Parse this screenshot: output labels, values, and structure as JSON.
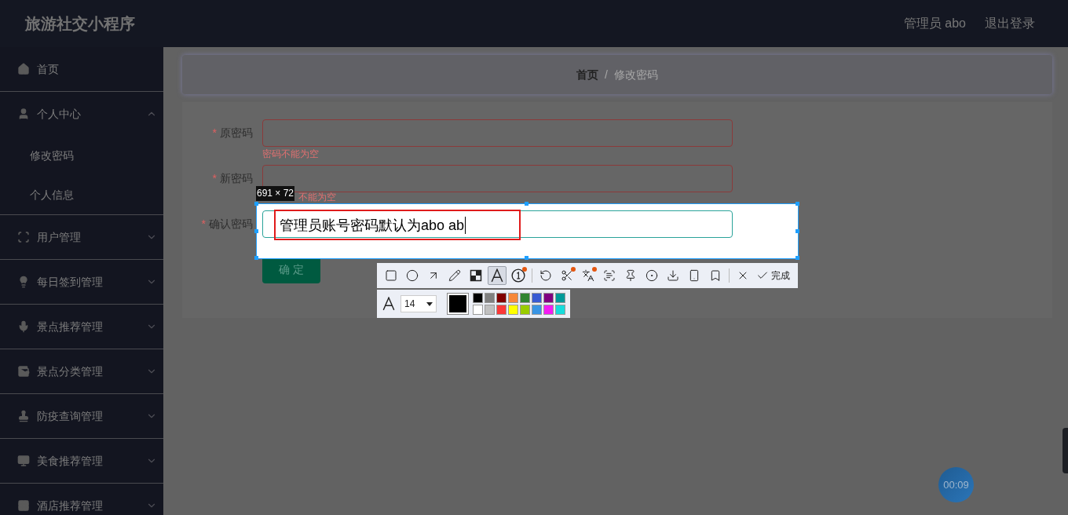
{
  "header": {
    "title": "旅游社交小程序",
    "user": "管理员 abo",
    "logout": "退出登录"
  },
  "sidebar": {
    "items": [
      {
        "label": "首页",
        "kind": "home"
      },
      {
        "label": "个人中心",
        "kind": "user",
        "expanded": true,
        "children": [
          {
            "label": "修改密码"
          },
          {
            "label": "个人信息"
          }
        ]
      },
      {
        "label": "用户管理",
        "kind": "scan",
        "expanded": false
      },
      {
        "label": "每日签到管理",
        "kind": "bulb",
        "expanded": false
      },
      {
        "label": "景点推荐管理",
        "kind": "mic",
        "expanded": false
      },
      {
        "label": "景点分类管理",
        "kind": "wallet",
        "expanded": false
      },
      {
        "label": "防疫查询管理",
        "kind": "stamp",
        "expanded": false
      },
      {
        "label": "美食推荐管理",
        "kind": "monitor",
        "expanded": false
      },
      {
        "label": "酒店推荐管理",
        "kind": "grid",
        "expanded": false
      }
    ]
  },
  "breadcrumb": [
    "首页",
    "/",
    "修改密码"
  ],
  "form": {
    "fields": [
      {
        "label": "原密码",
        "mark": "*",
        "error": "密码不能为空"
      },
      {
        "label": "新密码",
        "mark": "*",
        "error": "不能为空"
      },
      {
        "label": "确认密码",
        "mark": "*"
      }
    ],
    "submit": "确 定"
  },
  "capture": {
    "size_label": "691 × 72",
    "annotation": "管理员账号密码默认为abo ab",
    "tools": [
      {
        "kind": "rectangle",
        "selected": false,
        "badge": false
      },
      {
        "kind": "circle",
        "selected": false,
        "badge": false
      },
      {
        "kind": "arrow",
        "selected": false,
        "badge": false
      },
      {
        "kind": "pencil",
        "selected": false,
        "badge": false
      },
      {
        "kind": "mosaic",
        "selected": false,
        "badge": false
      },
      {
        "kind": "text",
        "selected": true,
        "badge": false
      },
      {
        "kind": "number",
        "selected": false,
        "badge": true
      },
      {
        "kind": "sep"
      },
      {
        "kind": "undo",
        "selected": false,
        "badge": false
      },
      {
        "kind": "scissors",
        "selected": false,
        "badge": true
      },
      {
        "kind": "translate",
        "selected": false,
        "badge": true
      },
      {
        "kind": "ocr",
        "selected": false,
        "badge": false
      },
      {
        "kind": "pin",
        "selected": false,
        "badge": false
      },
      {
        "kind": "record",
        "selected": false,
        "badge": false
      },
      {
        "kind": "download",
        "selected": false,
        "badge": false
      },
      {
        "kind": "phone",
        "selected": false,
        "badge": false
      },
      {
        "kind": "bookmark",
        "selected": false,
        "badge": false
      },
      {
        "kind": "sep"
      },
      {
        "kind": "close",
        "selected": false,
        "badge": false
      }
    ],
    "done": "完成",
    "font_size": "14",
    "current": {
      "color": "#000000"
    },
    "palette": [
      {
        "color": "#000000"
      },
      {
        "color": "#808080"
      },
      {
        "color": "#800000"
      },
      {
        "color": "#f7883a"
      },
      {
        "color": "#308430"
      },
      {
        "color": "#385ad3"
      },
      {
        "color": "#800080"
      },
      {
        "color": "#009999"
      },
      {
        "color": "#ffffff"
      },
      {
        "color": "#c0c0c0"
      },
      {
        "color": "#fb3838"
      },
      {
        "color": "#ffff00"
      },
      {
        "color": "#99cc00"
      },
      {
        "color": "#3894e4"
      },
      {
        "color": "#f31bf3"
      },
      {
        "color": "#16dcdc"
      }
    ]
  },
  "timer": "00:09"
}
